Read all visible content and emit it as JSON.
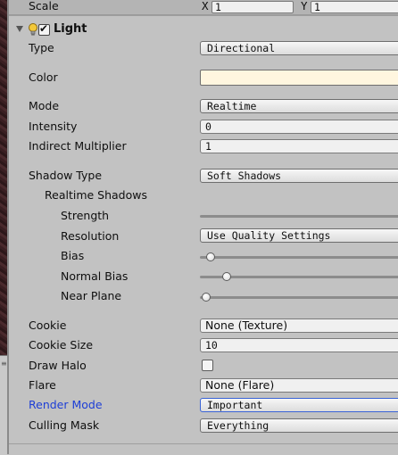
{
  "transform": {
    "scale_label": "Scale",
    "x_label": "X",
    "x_value": "1",
    "y_label": "Y",
    "y_value": "1"
  },
  "light": {
    "title": "Light",
    "enabled": true,
    "type_label": "Type",
    "type_value": "Directional",
    "color_label": "Color",
    "color_value": "#fff6df",
    "mode_label": "Mode",
    "mode_value": "Realtime",
    "intensity_label": "Intensity",
    "intensity_value": "0",
    "indirect_label": "Indirect Multiplier",
    "indirect_value": "1",
    "shadow_type_label": "Shadow Type",
    "shadow_type_value": "Soft Shadows",
    "realtime_shadows_label": "Realtime Shadows",
    "strength_label": "Strength",
    "strength_value": 1.0,
    "resolution_label": "Resolution",
    "resolution_value": "Use Quality Settings",
    "bias_label": "Bias",
    "bias_value": 0.05,
    "normal_bias_label": "Normal Bias",
    "normal_bias_value": 0.13,
    "near_plane_label": "Near Plane",
    "near_plane_value": 0.03,
    "cookie_label": "Cookie",
    "cookie_value": "None (Texture)",
    "cookie_size_label": "Cookie Size",
    "cookie_size_value": "10",
    "draw_halo_label": "Draw Halo",
    "draw_halo_checked": false,
    "flare_label": "Flare",
    "flare_value": "None (Flare)",
    "render_mode_label": "Render Mode",
    "render_mode_value": "Important",
    "culling_mask_label": "Culling Mask",
    "culling_mask_value": "Everything"
  },
  "colors": {
    "modified_label": "#1d3ed6",
    "panel_bg": "#c2c2c2"
  }
}
